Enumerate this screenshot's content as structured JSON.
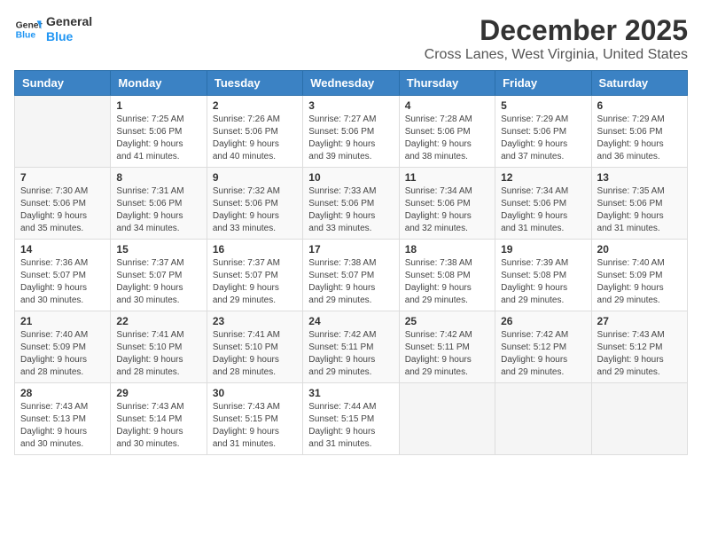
{
  "header": {
    "logo_line1": "General",
    "logo_line2": "Blue",
    "title": "December 2025",
    "subtitle": "Cross Lanes, West Virginia, United States"
  },
  "weekdays": [
    "Sunday",
    "Monday",
    "Tuesday",
    "Wednesday",
    "Thursday",
    "Friday",
    "Saturday"
  ],
  "weeks": [
    [
      {
        "day": "",
        "info": ""
      },
      {
        "day": "1",
        "info": "Sunrise: 7:25 AM\nSunset: 5:06 PM\nDaylight: 9 hours\nand 41 minutes."
      },
      {
        "day": "2",
        "info": "Sunrise: 7:26 AM\nSunset: 5:06 PM\nDaylight: 9 hours\nand 40 minutes."
      },
      {
        "day": "3",
        "info": "Sunrise: 7:27 AM\nSunset: 5:06 PM\nDaylight: 9 hours\nand 39 minutes."
      },
      {
        "day": "4",
        "info": "Sunrise: 7:28 AM\nSunset: 5:06 PM\nDaylight: 9 hours\nand 38 minutes."
      },
      {
        "day": "5",
        "info": "Sunrise: 7:29 AM\nSunset: 5:06 PM\nDaylight: 9 hours\nand 37 minutes."
      },
      {
        "day": "6",
        "info": "Sunrise: 7:29 AM\nSunset: 5:06 PM\nDaylight: 9 hours\nand 36 minutes."
      }
    ],
    [
      {
        "day": "7",
        "info": "Sunrise: 7:30 AM\nSunset: 5:06 PM\nDaylight: 9 hours\nand 35 minutes."
      },
      {
        "day": "8",
        "info": "Sunrise: 7:31 AM\nSunset: 5:06 PM\nDaylight: 9 hours\nand 34 minutes."
      },
      {
        "day": "9",
        "info": "Sunrise: 7:32 AM\nSunset: 5:06 PM\nDaylight: 9 hours\nand 33 minutes."
      },
      {
        "day": "10",
        "info": "Sunrise: 7:33 AM\nSunset: 5:06 PM\nDaylight: 9 hours\nand 33 minutes."
      },
      {
        "day": "11",
        "info": "Sunrise: 7:34 AM\nSunset: 5:06 PM\nDaylight: 9 hours\nand 32 minutes."
      },
      {
        "day": "12",
        "info": "Sunrise: 7:34 AM\nSunset: 5:06 PM\nDaylight: 9 hours\nand 31 minutes."
      },
      {
        "day": "13",
        "info": "Sunrise: 7:35 AM\nSunset: 5:06 PM\nDaylight: 9 hours\nand 31 minutes."
      }
    ],
    [
      {
        "day": "14",
        "info": "Sunrise: 7:36 AM\nSunset: 5:07 PM\nDaylight: 9 hours\nand 30 minutes."
      },
      {
        "day": "15",
        "info": "Sunrise: 7:37 AM\nSunset: 5:07 PM\nDaylight: 9 hours\nand 30 minutes."
      },
      {
        "day": "16",
        "info": "Sunrise: 7:37 AM\nSunset: 5:07 PM\nDaylight: 9 hours\nand 29 minutes."
      },
      {
        "day": "17",
        "info": "Sunrise: 7:38 AM\nSunset: 5:07 PM\nDaylight: 9 hours\nand 29 minutes."
      },
      {
        "day": "18",
        "info": "Sunrise: 7:38 AM\nSunset: 5:08 PM\nDaylight: 9 hours\nand 29 minutes."
      },
      {
        "day": "19",
        "info": "Sunrise: 7:39 AM\nSunset: 5:08 PM\nDaylight: 9 hours\nand 29 minutes."
      },
      {
        "day": "20",
        "info": "Sunrise: 7:40 AM\nSunset: 5:09 PM\nDaylight: 9 hours\nand 29 minutes."
      }
    ],
    [
      {
        "day": "21",
        "info": "Sunrise: 7:40 AM\nSunset: 5:09 PM\nDaylight: 9 hours\nand 28 minutes."
      },
      {
        "day": "22",
        "info": "Sunrise: 7:41 AM\nSunset: 5:10 PM\nDaylight: 9 hours\nand 28 minutes."
      },
      {
        "day": "23",
        "info": "Sunrise: 7:41 AM\nSunset: 5:10 PM\nDaylight: 9 hours\nand 28 minutes."
      },
      {
        "day": "24",
        "info": "Sunrise: 7:42 AM\nSunset: 5:11 PM\nDaylight: 9 hours\nand 29 minutes."
      },
      {
        "day": "25",
        "info": "Sunrise: 7:42 AM\nSunset: 5:11 PM\nDaylight: 9 hours\nand 29 minutes."
      },
      {
        "day": "26",
        "info": "Sunrise: 7:42 AM\nSunset: 5:12 PM\nDaylight: 9 hours\nand 29 minutes."
      },
      {
        "day": "27",
        "info": "Sunrise: 7:43 AM\nSunset: 5:12 PM\nDaylight: 9 hours\nand 29 minutes."
      }
    ],
    [
      {
        "day": "28",
        "info": "Sunrise: 7:43 AM\nSunset: 5:13 PM\nDaylight: 9 hours\nand 30 minutes."
      },
      {
        "day": "29",
        "info": "Sunrise: 7:43 AM\nSunset: 5:14 PM\nDaylight: 9 hours\nand 30 minutes."
      },
      {
        "day": "30",
        "info": "Sunrise: 7:43 AM\nSunset: 5:15 PM\nDaylight: 9 hours\nand 31 minutes."
      },
      {
        "day": "31",
        "info": "Sunrise: 7:44 AM\nSunset: 5:15 PM\nDaylight: 9 hours\nand 31 minutes."
      },
      {
        "day": "",
        "info": ""
      },
      {
        "day": "",
        "info": ""
      },
      {
        "day": "",
        "info": ""
      }
    ]
  ]
}
